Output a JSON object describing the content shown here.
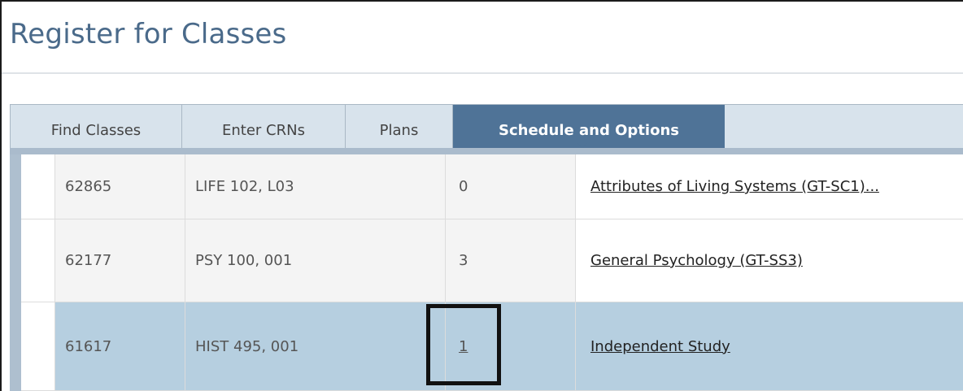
{
  "page": {
    "title": "Register for Classes"
  },
  "tabs": [
    {
      "label": "Find Classes",
      "active": false
    },
    {
      "label": "Enter CRNs",
      "active": false
    },
    {
      "label": "Plans",
      "active": false
    },
    {
      "label": "Schedule and Options",
      "active": true
    }
  ],
  "rows": [
    {
      "crn": "62865",
      "course": "LIFE 102, L03",
      "number": "0",
      "title": "Attributes of Living Systems (GT-SC1)..."
    },
    {
      "crn": "62177",
      "course": "PSY 100, 001",
      "number": "3",
      "title": "General Psychology (GT-SS3)"
    },
    {
      "crn": "61617",
      "course": "HIST 495, 001",
      "number": "1",
      "title": "Independent Study",
      "selected": true
    }
  ],
  "colors": {
    "title": "#4a6a8a",
    "active_tab": "#4f7397",
    "tab_bar": "#d8e3ec",
    "selected_row": "#b6cfe0"
  }
}
